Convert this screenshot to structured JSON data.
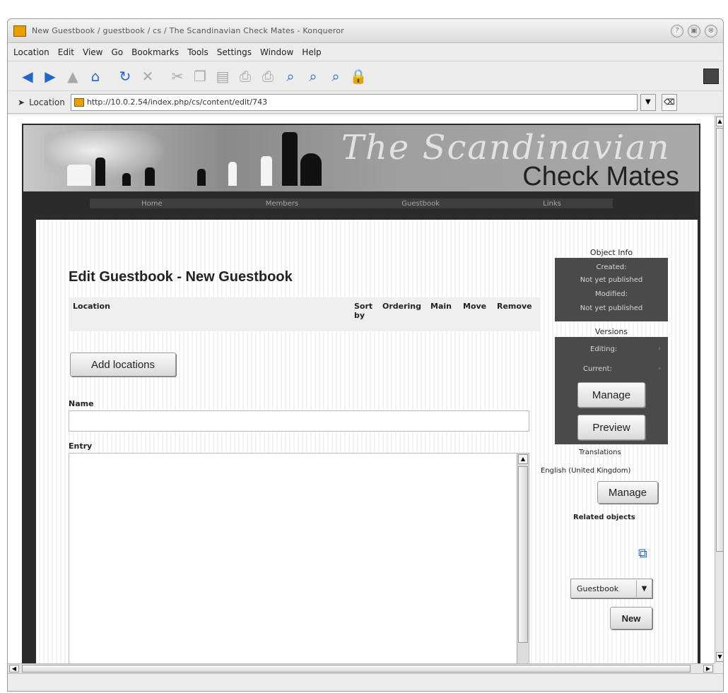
{
  "window": {
    "title": "New Guestbook / guestbook / cs / The Scandinavian Check Mates - Konqueror",
    "controls": [
      "?",
      "▣",
      "⊗"
    ]
  },
  "menu": [
    "Location",
    "Edit",
    "View",
    "Go",
    "Bookmarks",
    "Tools",
    "Settings",
    "Window",
    "Help"
  ],
  "locbar": {
    "label": "Location",
    "url": "http://10.0.2.54/index.php/cs/content/edit/743"
  },
  "site": {
    "script_title": "The Scandinavian",
    "brand": "Check Mates",
    "nav": [
      "Home",
      "Members",
      "Guestbook",
      "Links"
    ]
  },
  "page": {
    "heading": "Edit Guestbook - New Guestbook",
    "table_headers": [
      "Location",
      "Sort by",
      "Ordering",
      "Main",
      "Move",
      "Remove"
    ],
    "add_locations": "Add locations",
    "name_label": "Name",
    "name_value": "",
    "entry_label": "Entry",
    "entry_value": ""
  },
  "sidebar": {
    "object_info_title": "Object Info",
    "object_info_lines": [
      "Created:",
      "Not yet published",
      "Modified:",
      "Not yet published"
    ],
    "versions_title": "Versions",
    "versions_rows": [
      "Editing:",
      "Current:"
    ],
    "manage_label": "Manage",
    "preview_label": "Preview",
    "translations_title": "Translations",
    "translation_line": "English (United Kingdom)",
    "manage2_label": "Manage",
    "related_title": "Related objects",
    "class_select": "Guestbook",
    "new_label": "New"
  }
}
